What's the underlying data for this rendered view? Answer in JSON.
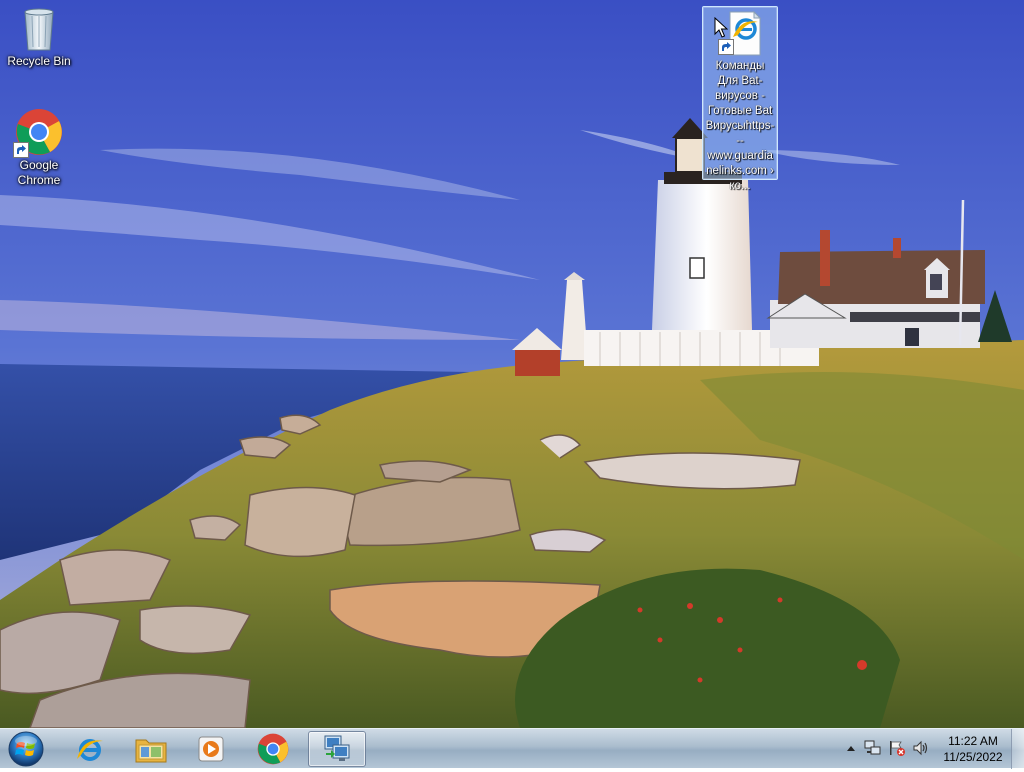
{
  "desktop": {
    "icons": [
      {
        "label": "Recycle Bin",
        "icon": "recycle-bin-icon"
      },
      {
        "label": "Google Chrome",
        "icon": "chrome-icon"
      },
      {
        "label": "Команды Для Bat-вирусов - Готовые Bat Вирусыhttps---www.guardianelinks.com › ко...",
        "icon": "ie-shortcut-icon"
      }
    ]
  },
  "taskbar": {
    "start": "windows-start-orb",
    "pinned": [
      {
        "icon": "internet-explorer-icon"
      },
      {
        "icon": "file-explorer-icon"
      },
      {
        "icon": "media-player-icon"
      },
      {
        "icon": "chrome-icon"
      },
      {
        "icon": "remote-connection-icon",
        "active": true
      }
    ],
    "tray": {
      "time": "11:22 AM",
      "date": "11/25/2022"
    }
  },
  "colors": {
    "sky_top": "#3c55c8",
    "sea": "#2c4aa0",
    "taskbar": "#a9bccd"
  }
}
